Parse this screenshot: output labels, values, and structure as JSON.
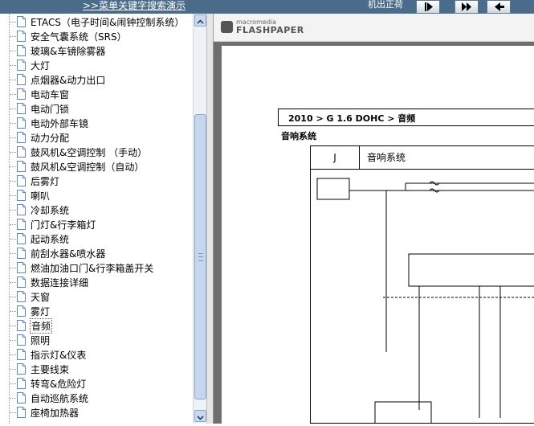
{
  "topbar": {
    "search_link": ">>菜单关键字搜索演示",
    "right_label": "机出正荷"
  },
  "tree": {
    "items": [
      {
        "label": "ETACS（电子时间&闹钟控制系统）"
      },
      {
        "label": "安全气囊系统（SRS）"
      },
      {
        "label": "玻璃&车镜除雾器"
      },
      {
        "label": "大灯"
      },
      {
        "label": "点烟器&动力出口"
      },
      {
        "label": "电动车窗"
      },
      {
        "label": "电动门锁"
      },
      {
        "label": "电动外部车镜"
      },
      {
        "label": "动力分配"
      },
      {
        "label": "鼓风机&空调控制 （手动）"
      },
      {
        "label": "鼓风机&空调控制（自动）"
      },
      {
        "label": "后雾灯"
      },
      {
        "label": "喇叭"
      },
      {
        "label": "冷却系统"
      },
      {
        "label": "门灯&行李箱灯"
      },
      {
        "label": "起动系统"
      },
      {
        "label": "前刮水器&喷水器"
      },
      {
        "label": "燃油加油口门&行李箱盖开关"
      },
      {
        "label": "数据连接详细"
      },
      {
        "label": "天窗"
      },
      {
        "label": "雾灯"
      },
      {
        "label": "音频"
      },
      {
        "label": "照明"
      },
      {
        "label": "指示灯&仪表"
      },
      {
        "label": "主要线束"
      },
      {
        "label": "转弯&危险灯"
      },
      {
        "label": "自动巡航系统"
      },
      {
        "label": "座椅加热器"
      }
    ],
    "selected": "音频"
  },
  "viewer": {
    "brand_small": "macromedia",
    "brand_big": "FLASHPAPER",
    "breadcrumb": "2010 > G 1.6 DOHC > 音频",
    "section_title": "音响系统",
    "diagram_code": "J",
    "diagram_title": "音响系统"
  },
  "colors": {
    "topbar_bg": "#4b6b8a",
    "viewer_bg": "#6e6e6e",
    "scrollbar_thumb": "#c5d6ee"
  }
}
